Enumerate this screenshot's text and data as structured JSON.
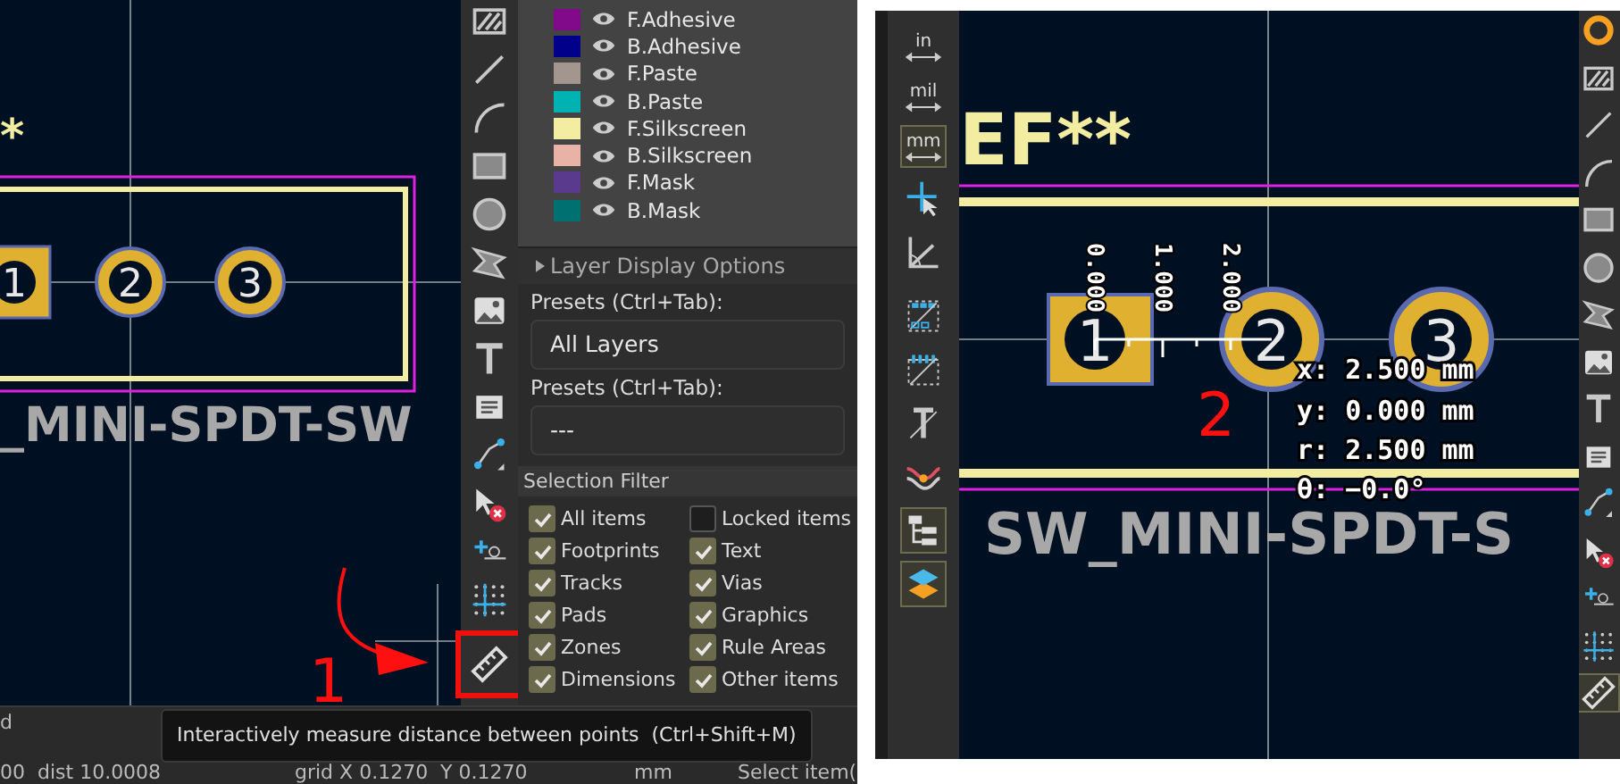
{
  "left_view": {
    "canvas": {
      "reference": "*",
      "value_text": "_MINI-SPDT-SW",
      "pads": [
        "1",
        "2",
        "3"
      ],
      "annotation": "1"
    },
    "toolbar": [
      {
        "kind": "hatch",
        "selected": false
      },
      {
        "kind": "line",
        "selected": false
      },
      {
        "kind": "arc",
        "selected": false
      },
      {
        "kind": "rectangle",
        "selected": false
      },
      {
        "kind": "circle",
        "selected": false
      },
      {
        "kind": "polygon",
        "selected": false
      },
      {
        "kind": "image",
        "selected": false
      },
      {
        "kind": "text",
        "selected": false
      },
      {
        "kind": "textbox",
        "selected": false
      },
      {
        "kind": "dimension",
        "selected": false
      },
      {
        "kind": "delete",
        "selected": false
      },
      {
        "kind": "origin",
        "selected": false
      },
      {
        "kind": "grid",
        "selected": false
      },
      {
        "kind": "measure",
        "selected": true
      }
    ],
    "layers": [
      {
        "name": "F.Adhesive",
        "color": "#800a8a"
      },
      {
        "name": "B.Adhesive",
        "color": "#00008a"
      },
      {
        "name": "F.Paste",
        "color": "#a3968f"
      },
      {
        "name": "B.Paste",
        "color": "#00b2b2"
      },
      {
        "name": "F.Silkscreen",
        "color": "#f2eda1"
      },
      {
        "name": "B.Silkscreen",
        "color": "#e8b2a7"
      },
      {
        "name": "F.Mask",
        "color": "#5a3a8c"
      },
      {
        "name": "B.Mask",
        "color": "#007070"
      }
    ],
    "layer_display_options": "Layer Display Options",
    "presets": [
      {
        "label": "Presets (Ctrl+Tab):",
        "value": "All Layers"
      },
      {
        "label": "Presets (Ctrl+Tab):",
        "value": "---"
      }
    ],
    "selection_filter": {
      "title": "Selection Filter",
      "items": [
        {
          "label": "All items",
          "checked": true
        },
        {
          "label": "Locked items",
          "checked": false
        },
        {
          "label": "Footprints",
          "checked": true
        },
        {
          "label": "Text",
          "checked": true
        },
        {
          "label": "Tracks",
          "checked": true
        },
        {
          "label": "Vias",
          "checked": true
        },
        {
          "label": "Pads",
          "checked": true
        },
        {
          "label": "Graphics",
          "checked": true
        },
        {
          "label": "Zones",
          "checked": true
        },
        {
          "label": "Rule Areas",
          "checked": true
        },
        {
          "label": "Dimensions",
          "checked": true
        },
        {
          "label": "Other items",
          "checked": true
        }
      ]
    },
    "tooltip": "Interactively measure distance between points  (Ctrl+Shift+M)",
    "status_bar": {
      "line_1": "d",
      "line_2": [
        "00  dist 10.0008",
        "grid X 0.1270  Y 0.1270",
        "mm",
        "Select item("
      ]
    }
  },
  "right_view": {
    "units": [
      {
        "label": "in",
        "selected": false
      },
      {
        "label": "mil",
        "selected": false
      },
      {
        "label": "mm",
        "selected": true
      }
    ],
    "left_toolbar": [
      {
        "kind": "cursor",
        "selected": false
      },
      {
        "kind": "polar",
        "selected": false
      },
      {
        "kind": "chip",
        "selected": false
      },
      {
        "kind": "chip2",
        "selected": false
      },
      {
        "kind": "track",
        "selected": false
      },
      {
        "kind": "curves",
        "selected": false
      },
      {
        "kind": "tree",
        "selected": true
      },
      {
        "kind": "layers",
        "selected": true
      }
    ],
    "canvas": {
      "reference": "EF**",
      "value_text": "SW_MINI-SPDT-S",
      "pads": [
        "1",
        "2",
        "3"
      ],
      "ruler_labels": [
        "0.000",
        "1.000",
        "2.000"
      ],
      "readout": [
        "x: 2.500 mm",
        "y: 0.000 mm",
        "r: 2.500 mm",
        "θ: −0.0°"
      ],
      "annotation": "2"
    },
    "right_toolbar": [
      {
        "kind": "via",
        "selected": false
      },
      {
        "kind": "hatch",
        "selected": false
      },
      {
        "kind": "line",
        "selected": false
      },
      {
        "kind": "arc",
        "selected": false
      },
      {
        "kind": "rectangle",
        "selected": false
      },
      {
        "kind": "circle",
        "selected": false
      },
      {
        "kind": "polygon",
        "selected": false
      },
      {
        "kind": "image",
        "selected": false
      },
      {
        "kind": "text",
        "selected": false
      },
      {
        "kind": "textbox",
        "selected": false
      },
      {
        "kind": "dimension",
        "selected": false
      },
      {
        "kind": "delete",
        "selected": false
      },
      {
        "kind": "origin",
        "selected": false
      },
      {
        "kind": "grid",
        "selected": false
      },
      {
        "kind": "measure",
        "selected": true
      }
    ]
  }
}
